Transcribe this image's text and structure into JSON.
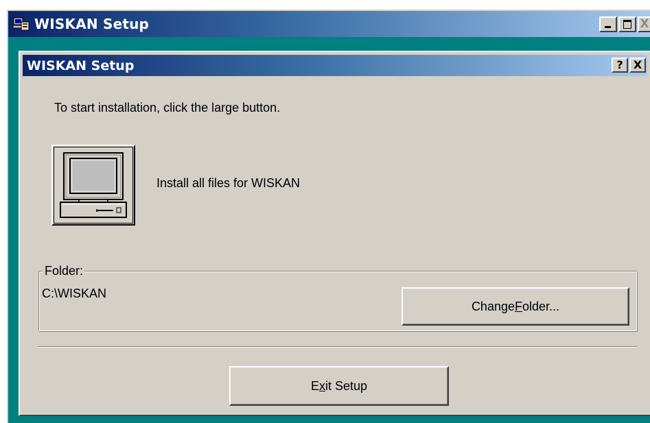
{
  "outer_window": {
    "title": "WISKAN Setup",
    "app_icon": "setup-computer-icon",
    "controls": {
      "minimize": "minimize-icon",
      "maximize": "maximize-icon",
      "close_glyph": "X"
    }
  },
  "dialog": {
    "title": "WISKAN Setup",
    "help_glyph": "?",
    "close_glyph": "X",
    "instruction": "To start installation, click the large button.",
    "install_button_icon": "computer-icon",
    "install_label": "Install all files for WISKAN",
    "folder": {
      "legend": "Folder:",
      "path": "C:\\WISKAN",
      "change_button": {
        "before": "Change ",
        "mnemonic": "F",
        "after": "older..."
      }
    },
    "exit_button": {
      "before": "E",
      "mnemonic": "x",
      "after": "it Setup"
    }
  },
  "colors": {
    "titlebar_start": "#0a246a",
    "titlebar_end": "#a6caf0",
    "desktop_teal": "#008080",
    "face": "#d4d0c8"
  }
}
